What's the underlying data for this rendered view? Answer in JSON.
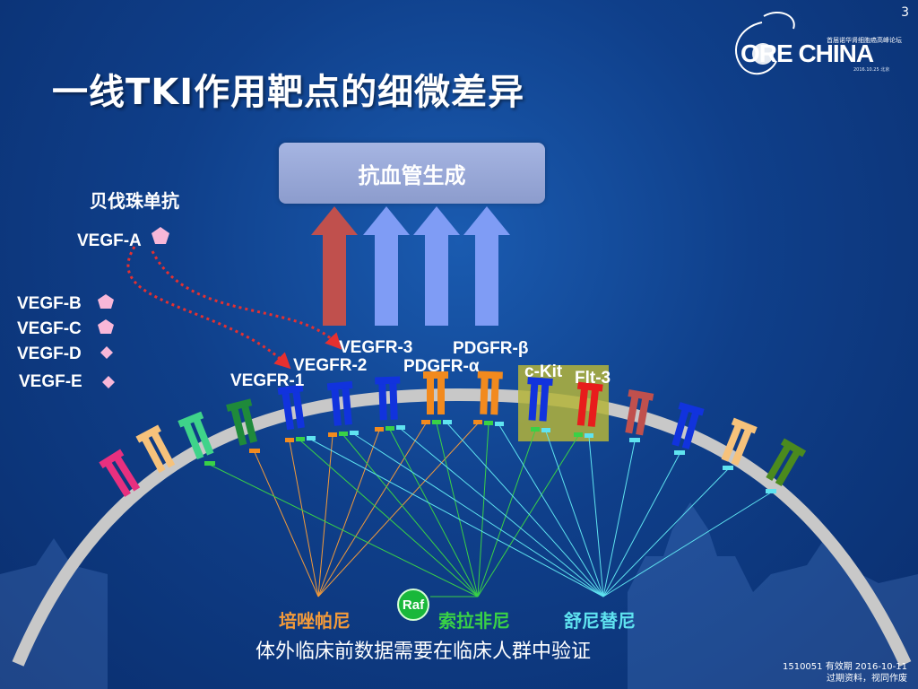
{
  "slide": {
    "page_number": "3",
    "title": "一线TKI作用靶点的细微差异",
    "logo": {
      "main": "ORE CHINA",
      "subtitle": "首届诺华肾细胞癌高峰论坛",
      "date": "2016.10.25 北京"
    },
    "outcome_box": "抗血管生成",
    "antibody_label": "贝伐珠单抗",
    "ligands": [
      "VEGF-A",
      "VEGF-B",
      "VEGF-C",
      "VEGF-D",
      "VEGF-E"
    ],
    "receptors": [
      "VEGFR-1",
      "VEGFR-2",
      "VEGFR-3",
      "PDGFR-α",
      "PDGFR-β",
      "c-Kit",
      "Flt-3"
    ],
    "raf_label": "Raf",
    "drugs": [
      {
        "name": "培唑帕尼",
        "color": "#f29a3a"
      },
      {
        "name": "索拉非尼",
        "color": "#39d146"
      },
      {
        "name": "舒尼替尼",
        "color": "#5fe3f0"
      }
    ],
    "footer_text": "体外临床前数据需要在临床人群中验证",
    "footnote_line1": "1510051  有效期  2016-10-11",
    "footnote_line2": "过期资料，视同作废"
  },
  "colors": {
    "background": "#0f3f8a",
    "arc": "#c8c8c8",
    "arrow_red": "#c0504d",
    "arrow_blue": "#7f9cf5",
    "box_fill": "#9aa9d8",
    "highlight": "#b4b43a",
    "dotted_line": "#e53030"
  }
}
